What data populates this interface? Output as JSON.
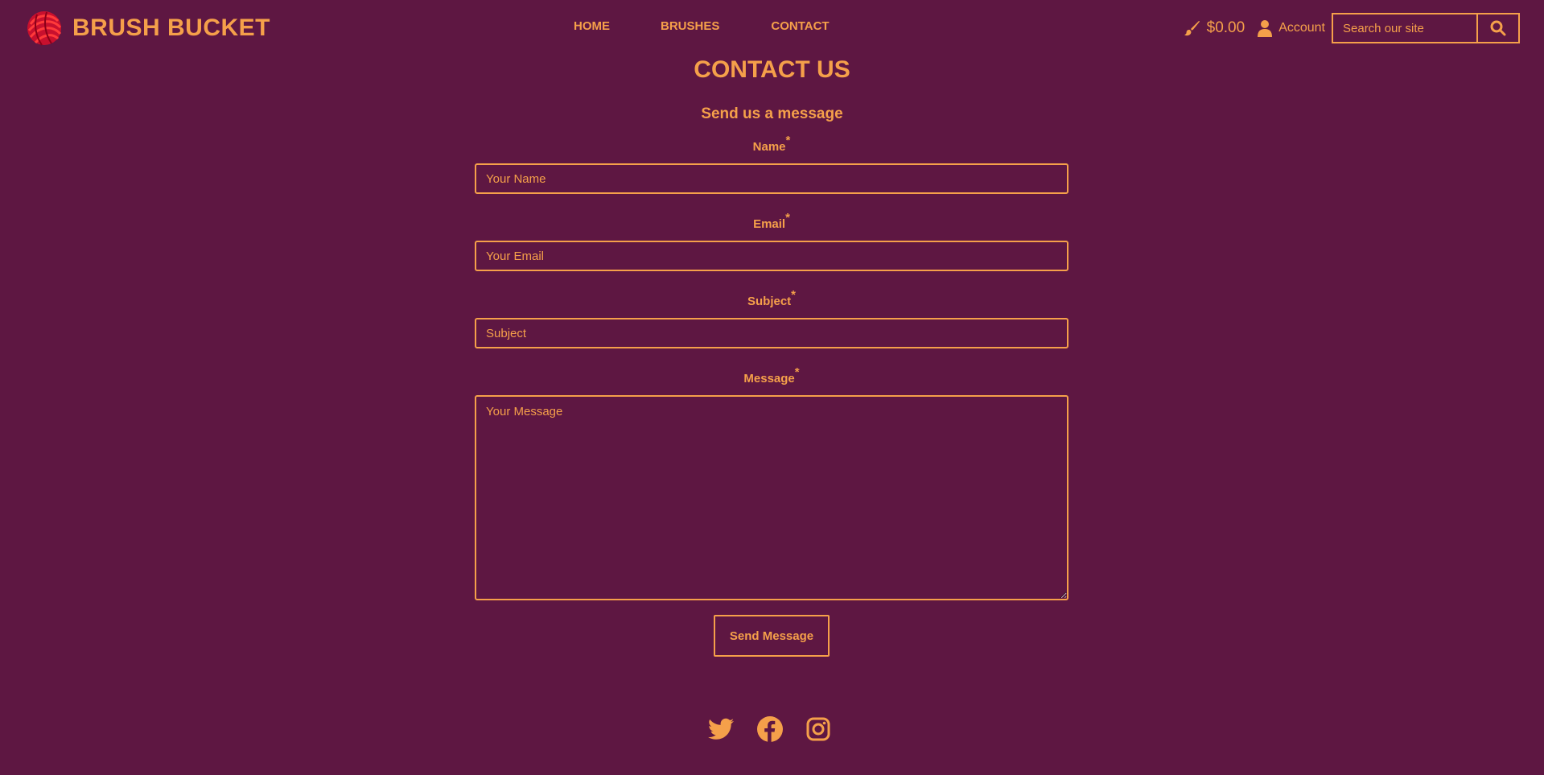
{
  "brand": {
    "name": "BRUSH BUCKET"
  },
  "nav": {
    "items": [
      {
        "label": "HOME"
      },
      {
        "label": "BRUSHES"
      },
      {
        "label": "CONTACT"
      }
    ]
  },
  "cart": {
    "amount": "$0.00",
    "icon": "paintbrush-icon"
  },
  "account": {
    "label": "Account",
    "icon": "user-icon"
  },
  "search": {
    "placeholder": "Search our site",
    "icon": "search-icon"
  },
  "page": {
    "title": "CONTACT US",
    "subtitle": "Send us a message"
  },
  "form": {
    "required_mark": "*",
    "name": {
      "label": "Name",
      "placeholder": "Your Name"
    },
    "email": {
      "label": "Email",
      "placeholder": "Your Email"
    },
    "subject": {
      "label": "Subject",
      "placeholder": "Subject"
    },
    "message": {
      "label": "Message",
      "placeholder": "Your Message"
    },
    "submit_label": "Send Message"
  },
  "social": [
    "twitter-icon",
    "facebook-icon",
    "instagram-icon"
  ],
  "colors": {
    "background": "#5e1742",
    "accent": "#f5a04a",
    "logo": "#e8202a"
  }
}
